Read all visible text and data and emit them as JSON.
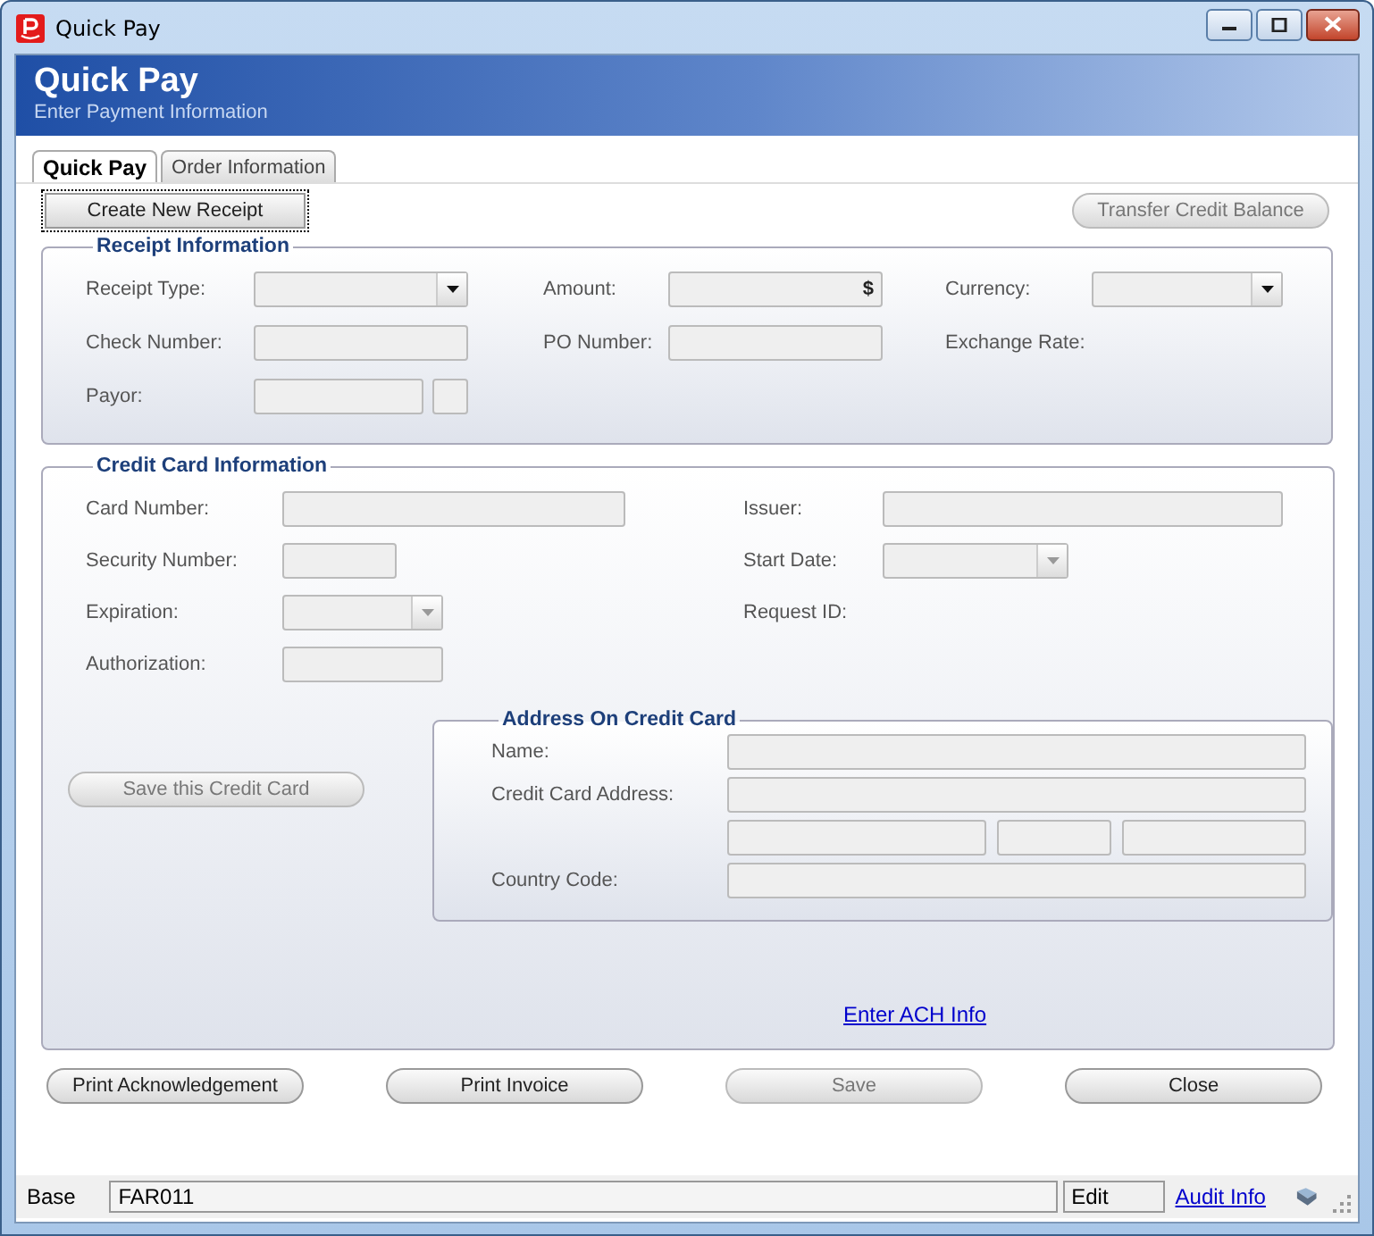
{
  "window": {
    "title": "Quick Pay"
  },
  "header": {
    "title": "Quick Pay",
    "subtitle": "Enter Payment Information"
  },
  "tabs": [
    {
      "label": "Quick Pay",
      "selected": true
    },
    {
      "label": "Order Information",
      "selected": false
    }
  ],
  "toolbar": [
    {
      "label": "Create New Receipt",
      "disabled": false
    },
    {
      "label": "Transfer Credit Balance",
      "disabled": true
    }
  ],
  "receipt_information": {
    "title": "Receipt Information",
    "rows": [
      [
        {
          "label": "Receipt Type:",
          "kind": "select",
          "disabled": false
        },
        {
          "label": "Amount:",
          "kind": "amount",
          "suffix": "$"
        },
        {
          "label": "Currency:",
          "kind": "select",
          "disabled": false
        }
      ],
      [
        {
          "label": "Check Number:",
          "kind": "text"
        },
        {
          "label": "PO Number:",
          "kind": "text"
        },
        {
          "label": "Exchange Rate:",
          "kind": "none"
        }
      ],
      [
        {
          "label": "Payor:",
          "kind": "payor"
        }
      ]
    ]
  },
  "credit_card_information": {
    "title": "Credit Card Information",
    "rows": [
      [
        {
          "label": "Card Number:",
          "kind": "text"
        },
        {
          "label": "Issuer:",
          "kind": "text"
        }
      ],
      [
        {
          "label": "Security Number:",
          "kind": "text"
        },
        {
          "label": "Start Date:",
          "kind": "select",
          "disabled": true
        }
      ],
      [
        {
          "label": "Expiration:",
          "kind": "select",
          "disabled": true
        },
        {
          "label": "Request ID:",
          "kind": "none"
        }
      ],
      [
        {
          "label": "Authorization:",
          "kind": "text"
        }
      ]
    ],
    "save_button": {
      "label": "Save this Credit Card",
      "disabled": true
    },
    "address": {
      "title": "Address On Credit Card",
      "rows": [
        {
          "label": "Name:",
          "kind": "text"
        },
        {
          "label": "Credit Card Address:",
          "kind": "text"
        },
        {
          "kind": "split"
        },
        {
          "label": "Country Code:",
          "kind": "text"
        }
      ]
    },
    "link": "Enter ACH Info"
  },
  "actions": [
    {
      "label": "Print Acknowledgement",
      "disabled": false
    },
    {
      "label": "Print Invoice",
      "disabled": false
    },
    {
      "label": "Save",
      "disabled": true
    },
    {
      "label": "Close",
      "disabled": false
    }
  ],
  "status_bar": {
    "mode": "Base",
    "code": "FAR011",
    "state": "Edit",
    "link": "Audit Info"
  }
}
